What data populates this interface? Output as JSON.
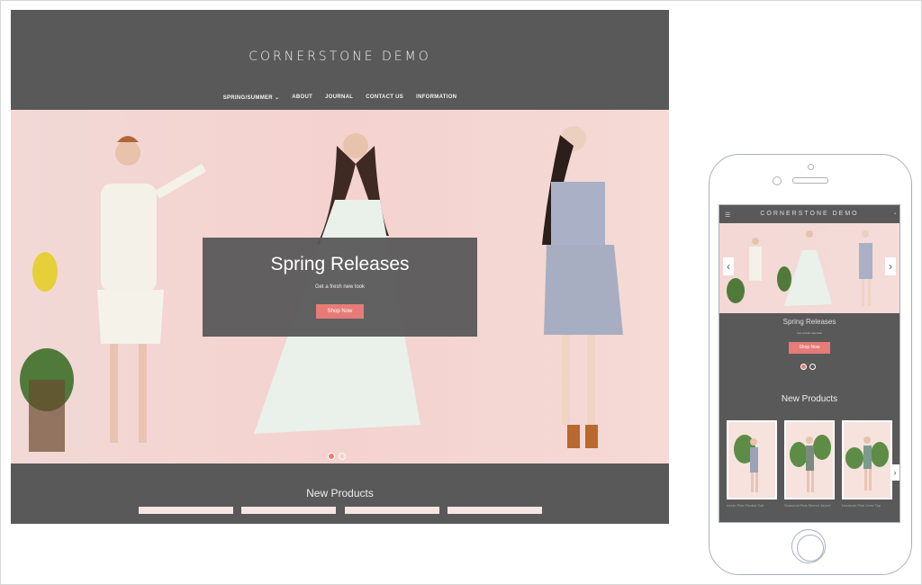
{
  "desktop": {
    "logo": "CORNERSTONE DEMO",
    "nav": [
      {
        "label": "SPRING/SUMMER"
      },
      {
        "label": "ABOUT"
      },
      {
        "label": "JOURNAL"
      },
      {
        "label": "CONTACT US"
      },
      {
        "label": "INFORMATION"
      }
    ],
    "hero": {
      "title": "Spring Releases",
      "subtitle": "Get a fresh new look",
      "button": "Shop Now",
      "slide_count": 2,
      "active_slide": 1
    },
    "new_products_title": "New Products"
  },
  "mobile": {
    "logo": "CORNERSTONE DEMO",
    "menu_icon": "hamburger-icon",
    "hero": {
      "title": "Spring Releases",
      "subtitle": "Get a fresh new look",
      "button": "Shop Now"
    },
    "new_products_title": "New Products",
    "products": [
      {
        "label": "Iconic Pink Printed Suit"
      },
      {
        "label": "Seasonal Pink Sleeve Jacket"
      },
      {
        "label": "Linoleum Pink Crew Top"
      }
    ]
  },
  "colors": {
    "header_bg": "#595959",
    "accent": "#e77b78",
    "hero_bg": "#f4d6d2"
  }
}
